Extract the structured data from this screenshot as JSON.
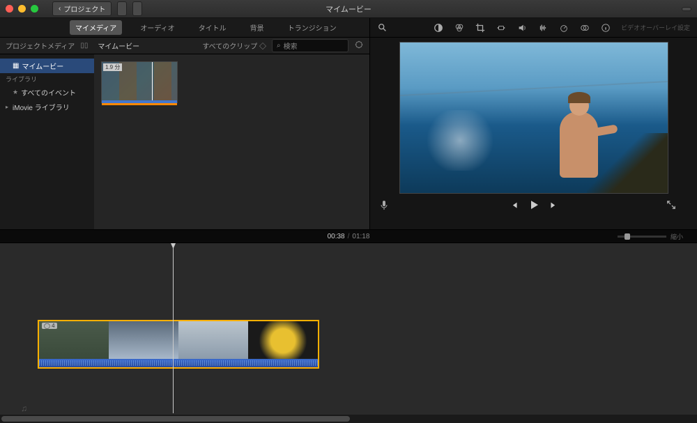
{
  "titlebar": {
    "back_label": "プロジェクト",
    "title": "マイムービー"
  },
  "tabs": {
    "my_media": "マイメディア",
    "audio": "オーディオ",
    "title_tab": "タイトル",
    "background": "背景",
    "transitions": "トランジション"
  },
  "browser_header": {
    "section": "プロジェクトメディア",
    "title": "マイムービー",
    "dropdown": "すべてのクリップ",
    "search_placeholder": "検索"
  },
  "sidebar": {
    "project_media": "プロジェクトメディア",
    "my_movie": "マイムービー",
    "library_section": "ライブラリ",
    "all_events": "すべてのイベント",
    "imovie_library": "iMovie ライブラリ"
  },
  "clip": {
    "duration_badge": "1.9 分"
  },
  "viewer_tools": {
    "disabled_text": "ビデオオーバーレイ設定"
  },
  "timecode": {
    "current": "00:38",
    "total": "01:18",
    "zoom_label": "縮小"
  },
  "timeline": {
    "clip_badge": "◯ 4"
  }
}
